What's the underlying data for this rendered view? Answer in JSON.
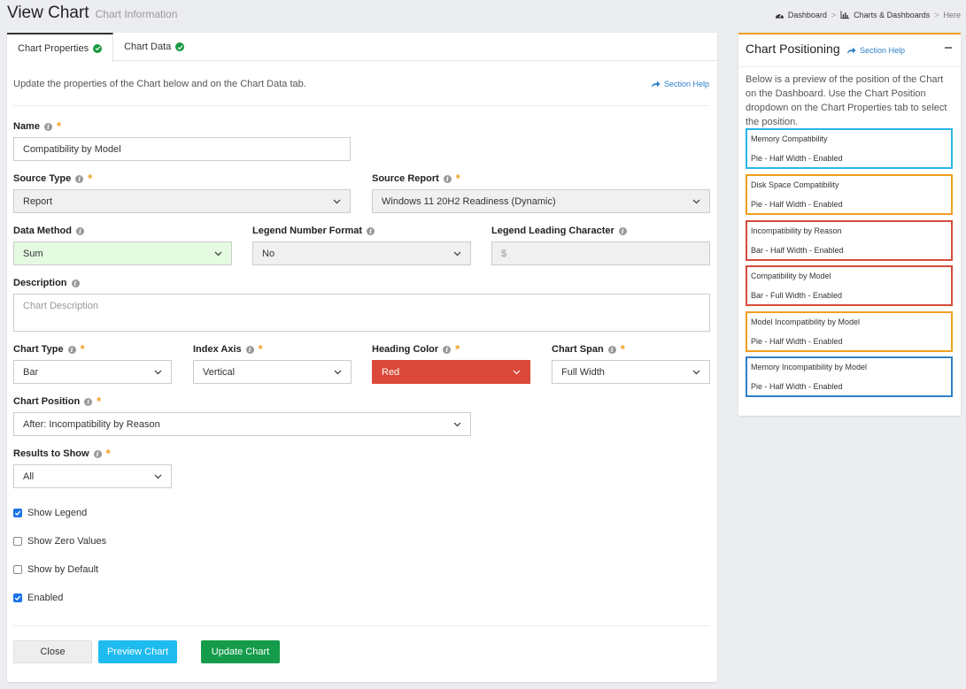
{
  "header": {
    "title": "View Chart",
    "subtitle": "Chart Information",
    "breadcrumb": [
      {
        "label": "Dashboard",
        "icon": "dashboard-icon"
      },
      {
        "label": "Charts & Dashboards",
        "icon": "bar-chart-icon"
      },
      {
        "label": "Here"
      }
    ],
    "separator": ">"
  },
  "tabs": [
    {
      "label": "Chart Properties",
      "active": true,
      "status": "check-icon"
    },
    {
      "label": "Chart Data",
      "active": false,
      "status": "check-icon"
    }
  ],
  "intro": "Update the properties of the Chart below and on the Chart Data tab.",
  "section_help": "Section Help",
  "form": {
    "name": {
      "label": "Name",
      "value": "Compatibility by Model"
    },
    "source_type": {
      "label": "Source Type",
      "value": "Report"
    },
    "source_report": {
      "label": "Source Report",
      "value": "Windows 11 20H2 Readiness (Dynamic)"
    },
    "data_method": {
      "label": "Data Method",
      "value": "Sum"
    },
    "legend_number_format": {
      "label": "Legend Number Format",
      "value": "No"
    },
    "legend_leading_character": {
      "label": "Legend Leading Character",
      "placeholder": "$"
    },
    "description": {
      "label": "Description",
      "placeholder": "Chart Description"
    },
    "chart_type": {
      "label": "Chart Type",
      "value": "Bar"
    },
    "index_axis": {
      "label": "Index Axis",
      "value": "Vertical"
    },
    "heading_color": {
      "label": "Heading Color",
      "value": "Red",
      "color": "#da4939"
    },
    "chart_span": {
      "label": "Chart Span",
      "value": "Full Width"
    },
    "chart_position": {
      "label": "Chart Position",
      "value": "After: Incompatibility by Reason"
    },
    "results_to_show": {
      "label": "Results to Show",
      "value": "All"
    }
  },
  "checkboxes": [
    {
      "label": "Show Legend",
      "checked": true
    },
    {
      "label": "Show Zero Values",
      "checked": false
    },
    {
      "label": "Show by Default",
      "checked": false
    },
    {
      "label": "Enabled",
      "checked": true
    }
  ],
  "buttons": {
    "close": "Close",
    "preview": "Preview Chart",
    "update": "Update Chart"
  },
  "side_panel": {
    "title": "Chart Positioning",
    "help": "Section Help",
    "description": "Below is a preview of the position of the Chart on the Dashboard. Use the Chart Position dropdown on the Chart Properties tab to select the position.",
    "positions": [
      {
        "name": "Memory Compatibility",
        "meta": "Pie - Half Width - Enabled",
        "color": "#29b6e8"
      },
      {
        "name": "Disk Space Compatibility",
        "meta": "Pie - Half Width - Enabled",
        "color": "#f0a020"
      },
      {
        "name": "Incompatibility by Reason",
        "meta": "Bar - Half Width - Enabled",
        "color": "#d64b3d"
      },
      {
        "name": "Compatibility by Model",
        "meta": "Bar - Full Width - Enabled",
        "color": "#d64b3d"
      },
      {
        "name": "Model Incompatibility by Model",
        "meta": "Pie - Half Width - Enabled",
        "color": "#f0a020"
      },
      {
        "name": "Memory Incompatibility by Model",
        "meta": "Pie - Half Width - Enabled",
        "color": "#2f80c8"
      }
    ]
  },
  "colors": {
    "accent": "#2f80c8",
    "required": "#f0a020",
    "success": "#149c4a",
    "info": "#1ebbf0"
  }
}
